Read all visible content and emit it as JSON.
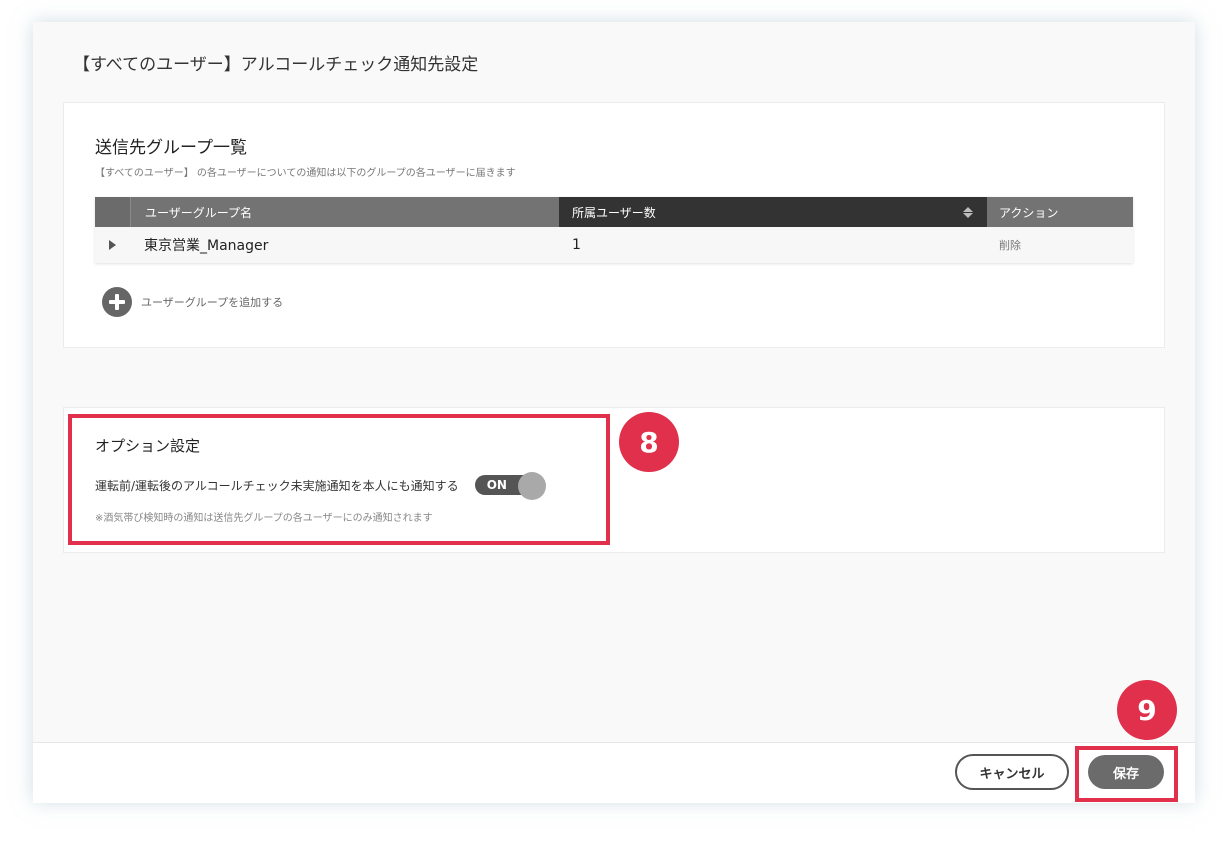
{
  "dialog": {
    "title": "【すべてのユーザー】アルコールチェック通知先設定"
  },
  "groups_section": {
    "title": "送信先グループ一覧",
    "subtitle": "【すべてのユーザー】 の各ユーザーについての通知は以下のグループの各ユーザーに届きます",
    "table": {
      "headers": {
        "name": "ユーザーグループ名",
        "count": "所属ユーザー数",
        "action": "アクション"
      },
      "rows": [
        {
          "name": "東京営業_Manager",
          "count": "1",
          "action": "削除"
        }
      ]
    },
    "add_group_label": "ユーザーグループを追加する"
  },
  "options_section": {
    "title": "オプション設定",
    "notify_self_label": "運転前/運転後のアルコールチェック未実施通知を本人にも通知する",
    "toggle_text": "ON",
    "toggle_on": true,
    "note": "※酒気帯び検知時の通知は送信先グループの各ユーザーにのみ通知されます"
  },
  "footer": {
    "cancel_label": "キャンセル",
    "save_label": "保存"
  },
  "annotations": {
    "badge_8": "8",
    "badge_9": "9"
  },
  "colors": {
    "highlight": "#e0304c",
    "table_header": "#737373",
    "table_header_sorted": "#333333",
    "toggle_track": "#555555"
  }
}
